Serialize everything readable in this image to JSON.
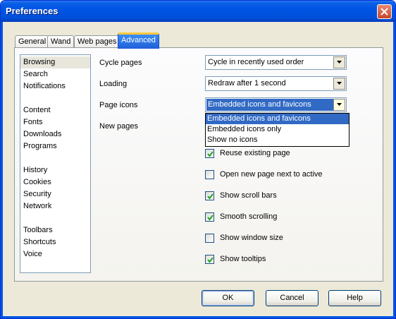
{
  "window": {
    "title": "Preferences"
  },
  "tabs": [
    {
      "label": "General"
    },
    {
      "label": "Wand"
    },
    {
      "label": "Web pages"
    },
    {
      "label": "Advanced",
      "active": true
    }
  ],
  "categories": {
    "groups": [
      [
        "Browsing",
        "Search",
        "Notifications"
      ],
      [
        "Content",
        "Fonts",
        "Downloads",
        "Programs"
      ],
      [
        "History",
        "Cookies",
        "Security",
        "Network"
      ],
      [
        "Toolbars",
        "Shortcuts",
        "Voice"
      ]
    ],
    "selected": "Browsing"
  },
  "settings": {
    "cycle_pages": {
      "label": "Cycle pages",
      "value": "Cycle in recently used order"
    },
    "loading": {
      "label": "Loading",
      "value": "Redraw after 1 second"
    },
    "page_icons": {
      "label": "Page icons",
      "value": "Embedded icons and favicons",
      "options": [
        "Embedded icons and favicons",
        "Embedded icons only",
        "Show no icons"
      ]
    },
    "new_pages": {
      "label": "New pages"
    }
  },
  "checkboxes": [
    {
      "label": "Reuse existing page",
      "checked": true
    },
    {
      "label": "Open new page next to active",
      "checked": false
    },
    {
      "label": "Show scroll bars",
      "checked": true
    },
    {
      "label": "Smooth scrolling",
      "checked": true
    },
    {
      "label": "Show window size",
      "checked": false
    },
    {
      "label": "Show tooltips",
      "checked": true
    }
  ],
  "buttons": {
    "ok": "OK",
    "cancel": "Cancel",
    "help": "Help"
  },
  "colors": {
    "titlebar": "#0054e3",
    "selection": "#316ac5",
    "active_tab_accent": "#ffc83c"
  },
  "icons": {
    "close": "close-icon",
    "dropdown_arrow": "chevron-down-icon",
    "checkmark": "checkmark-icon"
  }
}
